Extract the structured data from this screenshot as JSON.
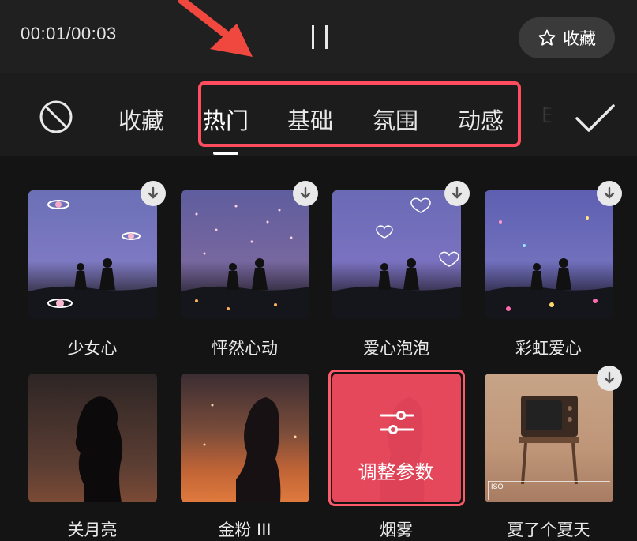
{
  "player": {
    "time": "00:01/00:03",
    "favorite_label": "收藏"
  },
  "tabs": [
    "收藏",
    "热门",
    "基础",
    "氛围",
    "动感"
  ],
  "active_tab": "热门",
  "effects": [
    {
      "name": "少女心"
    },
    {
      "name": "怦然心动"
    },
    {
      "name": "爱心泡泡"
    },
    {
      "name": "彩虹爱心"
    },
    {
      "name": "关月亮"
    },
    {
      "name": "金粉 III"
    },
    {
      "name": "烟雾",
      "selected": true,
      "overlay_label": "调整参数"
    },
    {
      "name": "夏了个夏天"
    }
  ],
  "tv_tag": "ISO",
  "colors": {
    "highlight": "#ff4d5f",
    "arrow": "#f0483e",
    "selected_card": "#e5475b"
  }
}
